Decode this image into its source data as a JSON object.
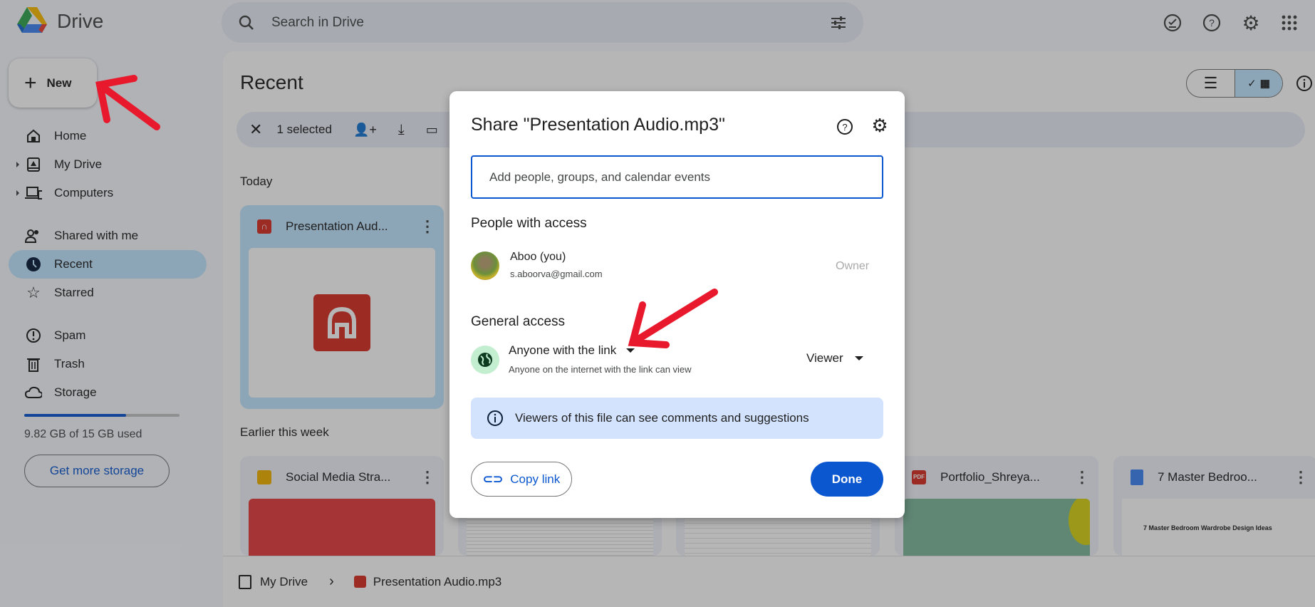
{
  "app": {
    "name": "Drive"
  },
  "search": {
    "placeholder": "Search in Drive"
  },
  "new_button": "New",
  "sidebar": {
    "items": [
      {
        "label": "Home",
        "icon": "home-icon"
      },
      {
        "label": "My Drive",
        "icon": "my-drive-icon"
      },
      {
        "label": "Computers",
        "icon": "computers-icon"
      },
      {
        "label": "Shared with me",
        "icon": "shared-icon"
      },
      {
        "label": "Recent",
        "icon": "clock-icon",
        "active": true
      },
      {
        "label": "Starred",
        "icon": "star-icon"
      },
      {
        "label": "Spam",
        "icon": "spam-icon"
      },
      {
        "label": "Trash",
        "icon": "trash-icon"
      },
      {
        "label": "Storage",
        "icon": "cloud-icon"
      }
    ],
    "storage": {
      "used_text": "9.82 GB of 15 GB used",
      "used_fraction": 0.655,
      "button": "Get more storage"
    }
  },
  "main": {
    "title": "Recent",
    "selection": "1 selected",
    "sections": {
      "today": "Today",
      "earlier": "Earlier this week"
    },
    "today_files": [
      {
        "name": "Presentation Aud...",
        "type": "audio"
      }
    ],
    "earlier_files": [
      {
        "name": "Social Media Stra...",
        "type": "slides"
      },
      {
        "name": "",
        "type": "sheet"
      },
      {
        "name": "",
        "type": "doc"
      },
      {
        "name": "Portfolio_Shreya...",
        "type": "pdf"
      },
      {
        "name": "7 Master Bedroo...",
        "type": "doc"
      }
    ],
    "doc_preview": {
      "title": "7 Master Bedroom Wardrobe Design Ideas"
    }
  },
  "breadcrumb": {
    "root": "My Drive",
    "file": "Presentation Audio.mp3"
  },
  "dialog": {
    "title": "Share \"Presentation Audio.mp3\"",
    "input_placeholder": "Add people, groups, and calendar events",
    "people_heading": "People with access",
    "person": {
      "name": "Aboo (you)",
      "email": "s.aboorva@gmail.com",
      "role": "Owner"
    },
    "general_heading": "General access",
    "access": {
      "label": "Anyone with the link",
      "desc": "Anyone on the internet with the link can view",
      "role": "Viewer"
    },
    "info": "Viewers of this file can see comments and suggestions",
    "copy_link": "Copy link",
    "done": "Done"
  },
  "colors": {
    "accent": "#0b57d0",
    "selected": "#c2e7ff",
    "annotation": "#e8192c"
  }
}
